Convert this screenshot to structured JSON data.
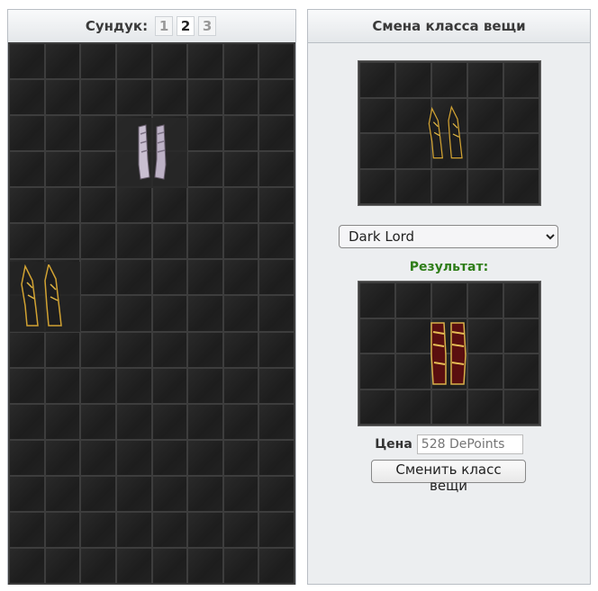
{
  "chest": {
    "title": "Сундук:",
    "pages": [
      "1",
      "2",
      "3"
    ],
    "active_page": "2",
    "items": [
      {
        "name": "silver-boots-item",
        "icon": "silver-boots-icon"
      },
      {
        "name": "dark-boots-item",
        "icon": "dark-spiked-boots-icon"
      }
    ]
  },
  "class_change": {
    "title": "Смена класса вещи",
    "source_item_icon": "dark-spiked-boots-icon",
    "selected_class": "Dark Lord",
    "class_options": [
      "Dark Lord"
    ],
    "result_label": "Результат:",
    "result_item_icon": "red-gold-boots-icon",
    "price_label": "Цена",
    "price_placeholder": "528 DePoints",
    "submit_label": "Сменить класс вещи"
  }
}
